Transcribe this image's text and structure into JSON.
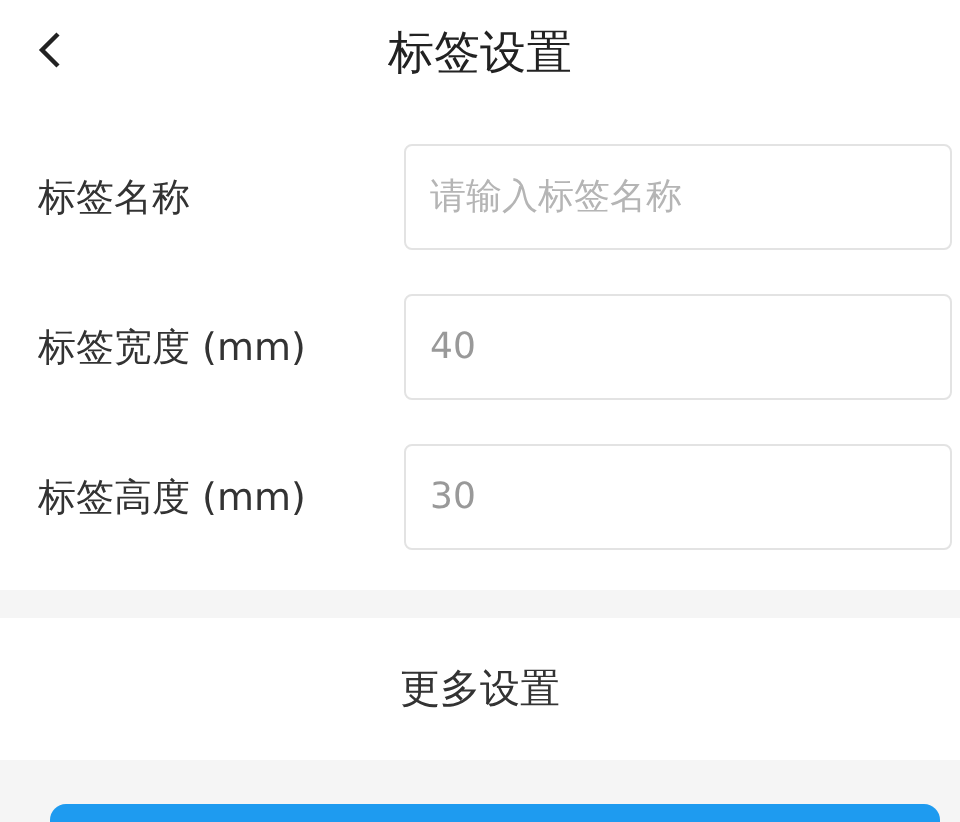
{
  "header": {
    "title": "标签设置"
  },
  "fields": [
    {
      "label": "标签名称",
      "placeholder": "请输入标签名称"
    },
    {
      "label": "标签宽度 (mm)",
      "value": "40"
    },
    {
      "label": "标签高度 (mm)",
      "value": "30"
    }
  ],
  "more_section": {
    "title": "更多设置"
  }
}
